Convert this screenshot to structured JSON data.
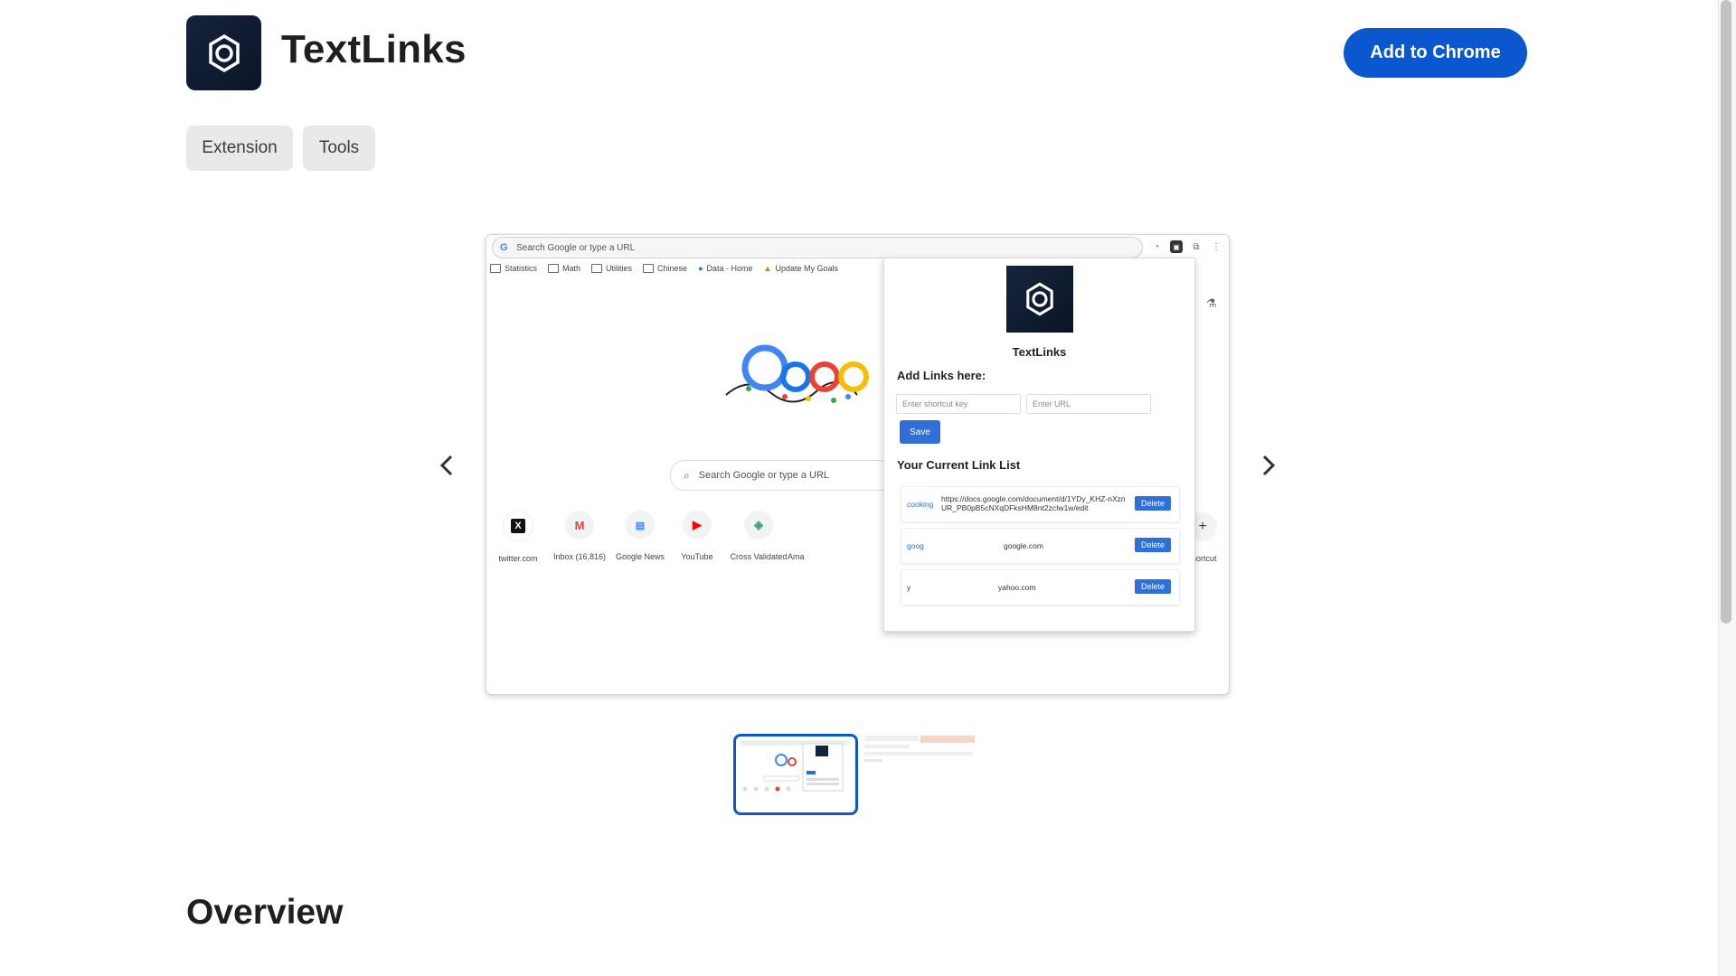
{
  "header": {
    "app_name": "TextLinks",
    "add_button": "Add to Chrome"
  },
  "chips": [
    "Extension",
    "Tools"
  ],
  "carousel": {
    "screenshot": {
      "omnibox_placeholder": "Search Google or type a URL",
      "bookmarks": [
        "Statistics",
        "Math",
        "Utilities",
        "Chinese",
        "Data - Home",
        "Update My Goals"
      ],
      "search_placeholder": "Search Google or type a URL",
      "tiles": [
        "twitter.com",
        "Inbox (16,816)",
        "Google News",
        "YouTube",
        "Cross Validated",
        "Ama"
      ],
      "shortcut_label": "hortcut",
      "popup": {
        "name": "TextLinks",
        "add_heading": "Add Links here:",
        "shortcut_placeholder": "Enter shortcut key",
        "url_placeholder": "Enter URL",
        "save_label": "Save",
        "list_heading": "Your Current Link List",
        "links": [
          {
            "key": "cooking",
            "url": "https://docs.google.com/document/d/1YDy_KHZ-nXznUR_PB0pB5cNXqDFksHM8nt2zcIw1w/edit",
            "delete": "Delete"
          },
          {
            "key": "goog",
            "url": "google.com",
            "delete": "Delete"
          },
          {
            "key": "y",
            "url": "yahoo.com",
            "delete": "Delete"
          }
        ]
      }
    },
    "thumbnail_count": 2,
    "selected_thumbnail": 1
  },
  "overview_heading": "Overview",
  "colors": {
    "accent": "#0b57d0",
    "logo_bg": "#0f1d33",
    "chip_bg": "#e9e9e9"
  }
}
